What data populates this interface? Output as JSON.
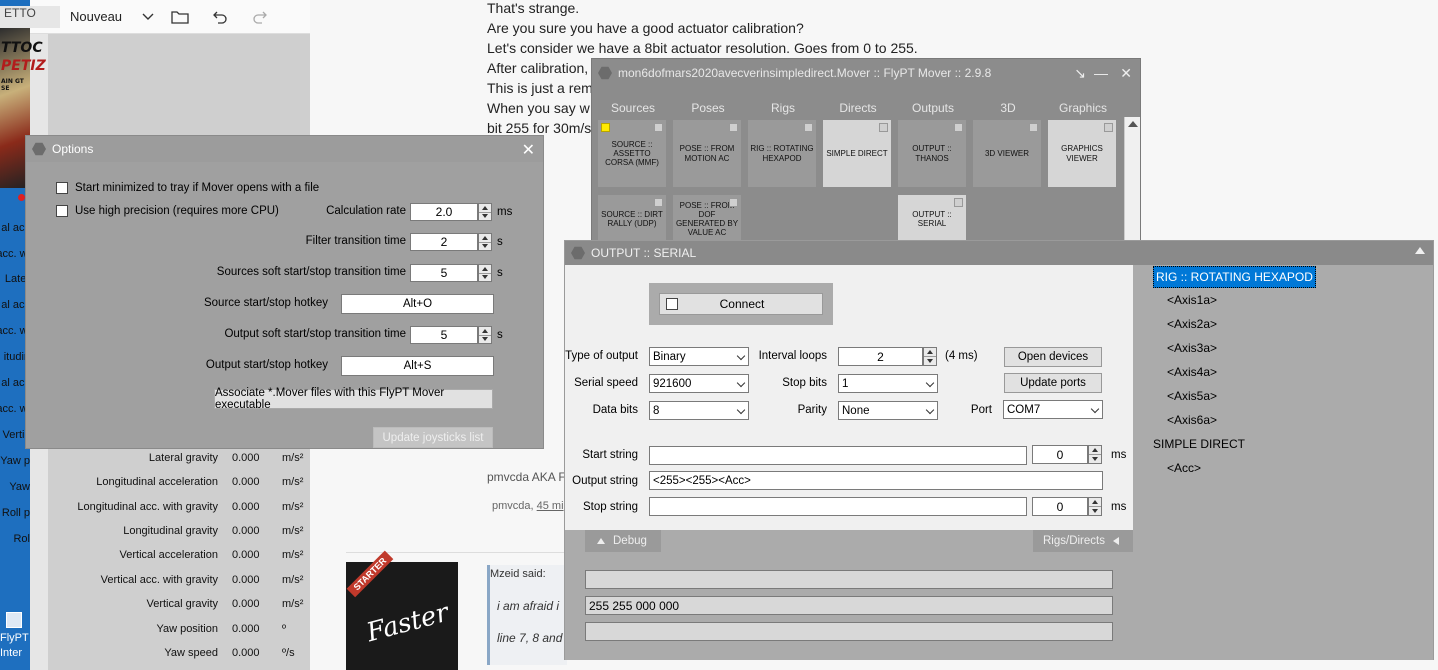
{
  "desktop": {
    "strip_labels": [
      "FlyPT",
      "Inter"
    ],
    "left_labels": [
      "al acc",
      "acc. wi",
      "Later",
      "al acc",
      "acc. wi",
      "itudin",
      "al acc",
      "acc. wi",
      "Vertic",
      "Yaw p",
      "Yaw",
      "Roll p",
      "Rol"
    ]
  },
  "photos": {
    "tab_label": "ETTO",
    "new_label": "Nouveau",
    "thumb_text": [
      "TTOC",
      "PETIZ",
      "AIN GT SE"
    ],
    "telemetry": [
      {
        "label": "Lateral gravity",
        "value": "0.000",
        "unit": "m/s²"
      },
      {
        "label": "Longitudinal acceleration",
        "value": "0.000",
        "unit": "m/s²"
      },
      {
        "label": "Longitudinal acc. with gravity",
        "value": "0.000",
        "unit": "m/s²"
      },
      {
        "label": "Longitudinal gravity",
        "value": "0.000",
        "unit": "m/s²"
      },
      {
        "label": "Vertical acceleration",
        "value": "0.000",
        "unit": "m/s²"
      },
      {
        "label": "Vertical acc. with gravity",
        "value": "0.000",
        "unit": "m/s²"
      },
      {
        "label": "Vertical gravity",
        "value": "0.000",
        "unit": "m/s²"
      },
      {
        "label": "Yaw position",
        "value": "0.000",
        "unit": "º"
      },
      {
        "label": "Yaw speed",
        "value": "0.000",
        "unit": "º/s"
      }
    ]
  },
  "forum": {
    "lines": [
      "That's strange.",
      "Are you sure you have a good actuator calibration?",
      "Let's consider we have a 8bit actuator resolution. Goes from 0 to 255.",
      "After calibration,",
      "This is just a rem",
      "When you say w",
      "bit 255 for 30m/s"
    ],
    "author": "pmvcda AKA F",
    "time_author": "pmvcda,",
    "time_link": "45 mi",
    "quote_head": "Mzeid said:",
    "quote_1": "i am afraid i",
    "quote_2": "line 7, 8 and",
    "starter_badge": "STARTER",
    "avatar_text": "Faster"
  },
  "options": {
    "title": "Options",
    "start_minimized": "Start minimized to tray if Mover opens with a file",
    "high_precision": "Use high precision (requires more CPU)",
    "calc_rate_label": "Calculation rate",
    "calc_rate_value": "2.0",
    "calc_rate_unit": "ms",
    "filter_label": "Filter transition time",
    "filter_value": "2",
    "filter_unit": "s",
    "sources_soft_label": "Sources soft start/stop transition time",
    "sources_soft_value": "5",
    "sources_soft_unit": "s",
    "source_hotkey_label": "Source start/stop hotkey",
    "source_hotkey_value": "Alt+O",
    "output_soft_label": "Output soft start/stop transition time",
    "output_soft_value": "5",
    "output_soft_unit": "s",
    "output_hotkey_label": "Output start/stop hotkey",
    "output_hotkey_value": "Alt+S",
    "associate_button": "Associate *.Mover files with this FlyPT Mover executable",
    "update_joysticks_button": "Update joysticks list"
  },
  "mover": {
    "title": "mon6dofmars2020avecverinsimpledirect.Mover :: FlyPT Mover :: 2.9.8",
    "tabs": [
      "Sources",
      "Poses",
      "Rigs",
      "Directs",
      "Outputs",
      "3D",
      "Graphics"
    ],
    "modules": [
      "SOURCE :: ASSETTO CORSA (MMF)",
      "POSE :: FROM MOTION AC",
      "RIG :: ROTATING HEXAPOD",
      "SIMPLE DIRECT",
      "OUTPUT :: THANOS",
      "3D VIEWER",
      "GRAPHICS VIEWER",
      "SOURCE :: DIRT RALLY (UDP)",
      "POSE :: FROM DOF GENERATED BY VALUE AC",
      "OUTPUT :: SERIAL"
    ]
  },
  "serial": {
    "title": "OUTPUT :: SERIAL",
    "connect_label": "Connect",
    "type_of_output_label": "Type of output",
    "type_of_output_value": "Binary",
    "serial_speed_label": "Serial speed",
    "serial_speed_value": "921600",
    "data_bits_label": "Data bits",
    "data_bits_value": "8",
    "interval_loops_label": "Interval loops",
    "interval_loops_value": "2",
    "interval_loops_ms": "(4 ms)",
    "stop_bits_label": "Stop bits",
    "stop_bits_value": "1",
    "parity_label": "Parity",
    "parity_value": "None",
    "port_label": "Port",
    "port_value": "COM7",
    "open_devices_button": "Open devices",
    "update_ports_button": "Update ports",
    "start_string_label": "Start string",
    "start_string_value": "",
    "start_ms_value": "0",
    "ms_unit": "ms",
    "output_string_label": "Output string",
    "output_string_value": "<255><255><Acc>",
    "stop_string_label": "Stop string",
    "stop_string_value": "",
    "stop_ms_value": "0",
    "debug_tab": "Debug",
    "rigs_tab": "Rigs/Directs",
    "debug_lines": [
      "",
      "255 255 000 000",
      ""
    ],
    "tree": [
      "RIG :: ROTATING HEXAPOD",
      "<Axis1a>",
      "<Axis2a>",
      "<Axis3a>",
      "<Axis4a>",
      "<Axis5a>",
      "<Axis6a>",
      "SIMPLE DIRECT",
      "<Acc>"
    ]
  }
}
